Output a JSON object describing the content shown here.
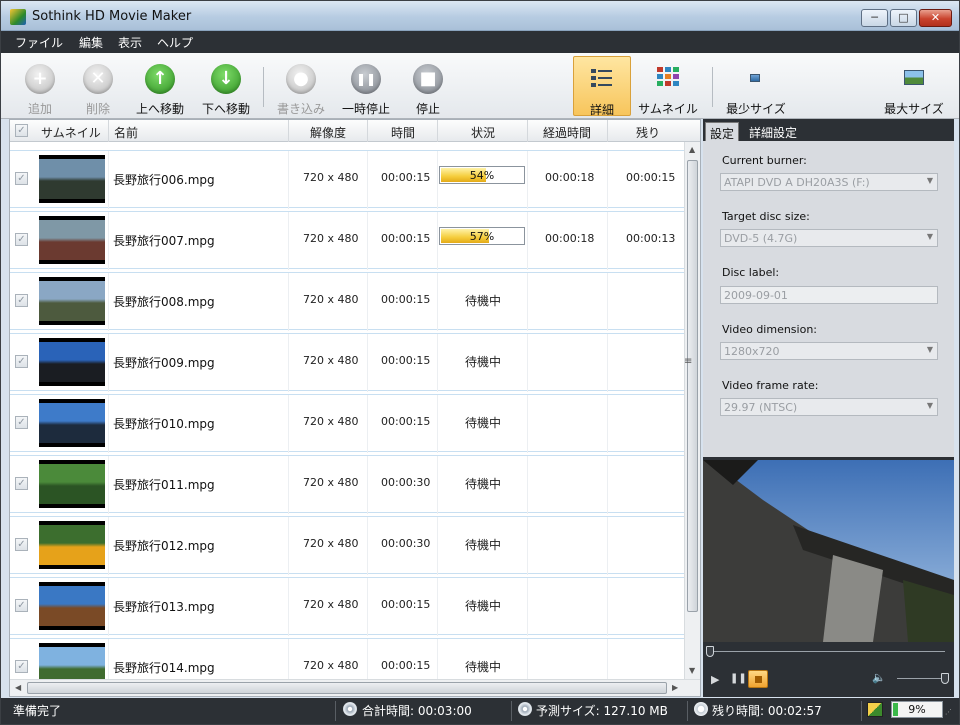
{
  "window": {
    "title": "Sothink HD Movie Maker",
    "controls": {
      "minimize": "─",
      "maximize": "□",
      "close": "✕"
    }
  },
  "menu": [
    "ファイル",
    "編集",
    "表示",
    "ヘルプ"
  ],
  "toolbar": {
    "add": "追加",
    "delete": "削除",
    "move_up": "上へ移動",
    "move_down": "下へ移動",
    "write": "書き込み",
    "pause": "一時停止",
    "stop": "停止",
    "view_detail": "詳細",
    "view_thumbnail": "サムネイル",
    "min_size": "最少サイズ",
    "max_size": "最大サイズ",
    "icons": {
      "add": "plus-icon",
      "delete": "x-icon",
      "move_up": "arrow-up-icon",
      "move_down": "arrow-down-icon",
      "write": "record-icon",
      "pause": "pause-icon",
      "stop": "stop-icon"
    }
  },
  "list": {
    "columns": {
      "thumbnail": "サムネイル",
      "name": "名前",
      "resolution": "解像度",
      "time": "時間",
      "status": "状況",
      "elapsed": "経過時間",
      "remaining": "残り"
    },
    "rows": [
      {
        "name": "長野旅行006.mpg",
        "resolution": "720 x 480",
        "time": "00:00:15",
        "status": "",
        "progress": 54,
        "progress_label": "54%",
        "elapsed": "00:00:18",
        "remaining": "00:00:15",
        "colors": [
          "#6f8fa9",
          "#2f3a30"
        ]
      },
      {
        "name": "長野旅行007.mpg",
        "resolution": "720 x 480",
        "time": "00:00:15",
        "status": "",
        "progress": 57,
        "progress_label": "57%",
        "elapsed": "00:00:18",
        "remaining": "00:00:13",
        "colors": [
          "#7f98a6",
          "#6b3a30"
        ]
      },
      {
        "name": "長野旅行008.mpg",
        "resolution": "720 x 480",
        "time": "00:00:15",
        "status": "待機中",
        "elapsed": "",
        "remaining": "",
        "colors": [
          "#8aa7c4",
          "#4d5a3e"
        ]
      },
      {
        "name": "長野旅行009.mpg",
        "resolution": "720 x 480",
        "time": "00:00:15",
        "status": "待機中",
        "elapsed": "",
        "remaining": "",
        "colors": [
          "#2a63b8",
          "#1a1d22"
        ]
      },
      {
        "name": "長野旅行010.mpg",
        "resolution": "720 x 480",
        "time": "00:00:15",
        "status": "待機中",
        "elapsed": "",
        "remaining": "",
        "colors": [
          "#3e7bc9",
          "#1d2b3d"
        ]
      },
      {
        "name": "長野旅行011.mpg",
        "resolution": "720 x 480",
        "time": "00:00:30",
        "status": "待機中",
        "elapsed": "",
        "remaining": "",
        "colors": [
          "#4b8a3a",
          "#2b5424"
        ]
      },
      {
        "name": "長野旅行012.mpg",
        "resolution": "720 x 480",
        "time": "00:00:30",
        "status": "待機中",
        "elapsed": "",
        "remaining": "",
        "colors": [
          "#3c6e2e",
          "#e6a21a"
        ]
      },
      {
        "name": "長野旅行013.mpg",
        "resolution": "720 x 480",
        "time": "00:00:15",
        "status": "待機中",
        "elapsed": "",
        "remaining": "",
        "colors": [
          "#3a78c4",
          "#7a4a26"
        ]
      },
      {
        "name": "長野旅行014.mpg",
        "resolution": "720 x 480",
        "time": "00:00:15",
        "status": "待機中",
        "elapsed": "",
        "remaining": "",
        "colors": [
          "#7fb2e0",
          "#3f6b2f"
        ]
      }
    ]
  },
  "settings": {
    "tabs": [
      "設定",
      "詳細設定"
    ],
    "current_burner": {
      "label": "Current burner:",
      "value": "ATAPI DVD A  DH20A3S (F:)"
    },
    "target_disc": {
      "label": "Target disc size:",
      "value": "DVD-5 (4.7G)"
    },
    "disc_label": {
      "label": "Disc label:",
      "value": "2009-09-01"
    },
    "video_dimension": {
      "label": "Video dimension:",
      "value": "1280x720"
    },
    "frame_rate": {
      "label": "Video frame rate:",
      "value": "29.97 (NTSC)"
    }
  },
  "player": {
    "play": "▶",
    "pause": "❚❚",
    "volume": "🔈",
    "seek_position": 0,
    "volume_level": 1.0
  },
  "status": {
    "ready": "準備完了",
    "total_time": "合計時間: 00:03:00",
    "estimated_size": "予測サイズ: 127.10 MB",
    "remaining_time": "残り時間: 00:02:57",
    "overall_progress": "9%",
    "overall_progress_value": 9
  }
}
